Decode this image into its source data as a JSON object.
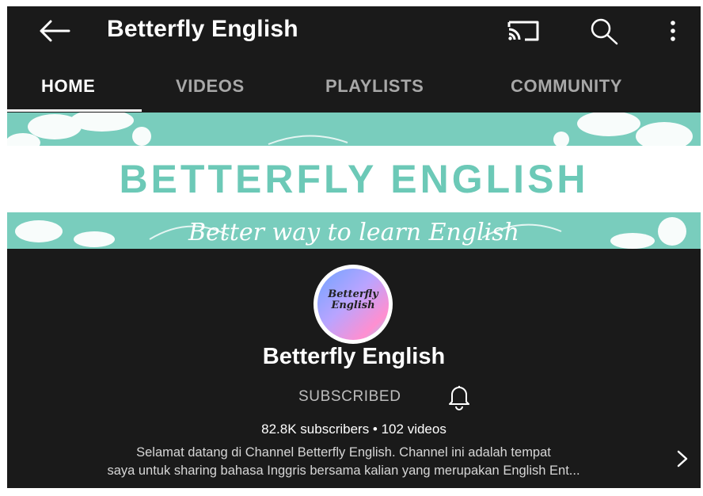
{
  "app_bar": {
    "title": "Betterfly English",
    "back_icon": "arrow-left-icon",
    "cast_icon": "cast-icon",
    "search_icon": "search-icon",
    "more_icon": "more-vertical-icon"
  },
  "tabs": [
    {
      "label": "HOME",
      "active": true
    },
    {
      "label": "VIDEOS",
      "active": false
    },
    {
      "label": "PLAYLISTS",
      "active": false
    },
    {
      "label": "COMMUNITY",
      "active": false
    }
  ],
  "banner": {
    "title": "BETTERFLY ENGLISH",
    "tagline": "Better way to learn English",
    "background_color": "#79cdbd"
  },
  "channel": {
    "avatar_text_line1": "Betterfly",
    "avatar_text_line2": "English",
    "name": "Betterfly English",
    "subscribe_label": "SUBSCRIBED",
    "bell_icon": "bell-icon",
    "stats": "82.8K subscribers • 102 videos",
    "description_line1": "Selamat datang di Channel Betterfly English. Channel ini adalah tempat",
    "description_line2": "saya untuk sharing bahasa Inggris bersama kalian yang merupakan English Ent...",
    "expand_icon": "chevron-right-icon"
  }
}
